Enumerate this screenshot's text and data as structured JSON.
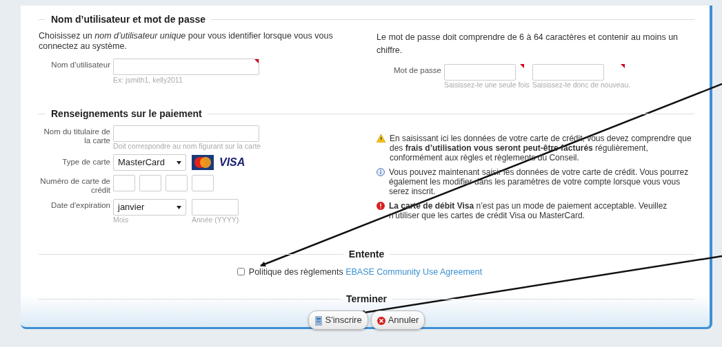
{
  "account": {
    "title": "Nom d’utilisateur et mot de passe",
    "intro": "Choisissez un *nom d’utilisateur unique* pour vous identifier lorsque vous vous connectez au système.",
    "username": {
      "label": "Nom d’utilisateur",
      "hint": "Ex: jsmith1, kelly2011",
      "required": true
    },
    "password_rule": "Le mot de passe doit comprendre de 6 à 64 caractères et contenir au moins un chiffre.",
    "password": {
      "label": "Mot de passe",
      "fields": [
        {
          "hint": "Saisissez-le une seule fois",
          "required": true
        },
        {
          "hint": "Saisissez-le donc de nouveau.",
          "required": true
        }
      ]
    }
  },
  "payment": {
    "title": "Renseignements sur le paiement",
    "holder": {
      "label": "Nom du titulaire de la carte",
      "hint": "Doit correspondre au nom figurant sur la carte"
    },
    "card_type": {
      "label": "Type de carte",
      "value": "MasterCard",
      "logos": [
        {
          "kind": "mastercard"
        },
        {
          "kind": "visa",
          "text": "VISA"
        }
      ]
    },
    "card_number": {
      "label": "Numéro de carte de crédit"
    },
    "expiry": {
      "label": "Date d'expiration",
      "month": {
        "value": "janvier",
        "hint": "Mois"
      },
      "year": {
        "hint": "Année (YYYY)"
      }
    },
    "notices": [
      {
        "kind": "warning",
        "text": "En saisissant ici les données de votre carte de crédit, vous devez comprendre que des **frais d’utilisation vous seront peut-être facturés** régulièrement, conformément aux règles et règlements du Conseil."
      },
      {
        "kind": "info",
        "text": "Vous pouvez maintenant saisir les données de votre carte de crédit. Vous pourrez également les modifier dans les paramètres de votre compte lorsque vous vous serez inscrit."
      },
      {
        "kind": "error",
        "text": "**La carte de débit Visa** n’est pas un mode de paiement acceptable. Veuillez n’utiliser que les cartes de crédit Visa ou MasterCard."
      }
    ]
  },
  "agreement": {
    "title": "Entente",
    "checked": false,
    "label": "Politique des règlements",
    "link": "EBASE Community Use Agreement"
  },
  "finish": {
    "title": "Terminer",
    "buttons": [
      {
        "kind": "submit",
        "label": "S'inscrire"
      },
      {
        "kind": "cancel",
        "label": "Annuler"
      }
    ]
  }
}
